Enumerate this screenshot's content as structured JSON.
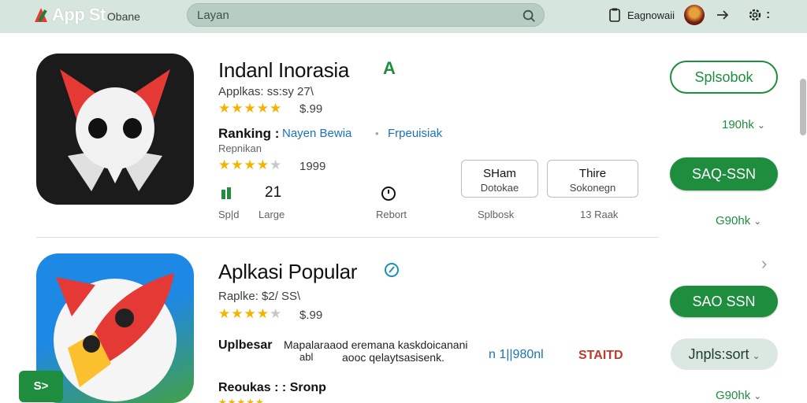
{
  "header": {
    "logo_text": "App St",
    "logo_sub": "Obane",
    "search_value": "Layan",
    "user_label": "Eagnowaii"
  },
  "apps": [
    {
      "title": "Indanl Inorasia",
      "title_badge": "A",
      "subtitle": "Applkas: ss:sy 27\\",
      "price": "$.99",
      "ranking_label": "Ranking :",
      "ranking_link1": "Nayen Bewia",
      "ranking_link2": "Frpeuisiak",
      "secondary_label": "Repnikan",
      "secondary_price": "1999",
      "stats": [
        {
          "value": "",
          "label": "Sp|d"
        },
        {
          "value": "21",
          "label": "Large"
        },
        {
          "value": "",
          "label": "Rebort"
        },
        {
          "value": "",
          "label": "Splbosk"
        },
        {
          "value": "",
          "label": "13 Raak"
        }
      ],
      "box1": {
        "line1": "SHam",
        "line2": "Dotokae"
      },
      "box2": {
        "line1": "Thire",
        "line2": "Sokonegn"
      }
    },
    {
      "title": "Aplkasi Popular",
      "subtitle": "Raplke: $2/ SS\\",
      "price": "$.99",
      "row_label": "Uplbesar",
      "row_text1": "Mapalaraaod eremana kaskdoicanani",
      "row_text2": "aooc qelaytsasisenk.",
      "row_text2_prefix": "abl",
      "row_link": "n 1||980nl",
      "row_red": "STAITD",
      "bottom_label": "Reoukas : : Sronp"
    }
  ],
  "right_column": {
    "btn_outline_label": "Splsobok",
    "count1": "190hk",
    "btn_filled1_label": "SAQ-SSN",
    "count2": "G90hk",
    "btn_filled2_label": "SAO SSN",
    "btn_grey_label": "Jnpls:sort",
    "count3": "G90hk"
  },
  "fab_label": "S>",
  "colors": {
    "accent": "#1e8e3e",
    "topbar": "#d6e6de",
    "link": "#1a73b8",
    "star": "#f2b400"
  }
}
